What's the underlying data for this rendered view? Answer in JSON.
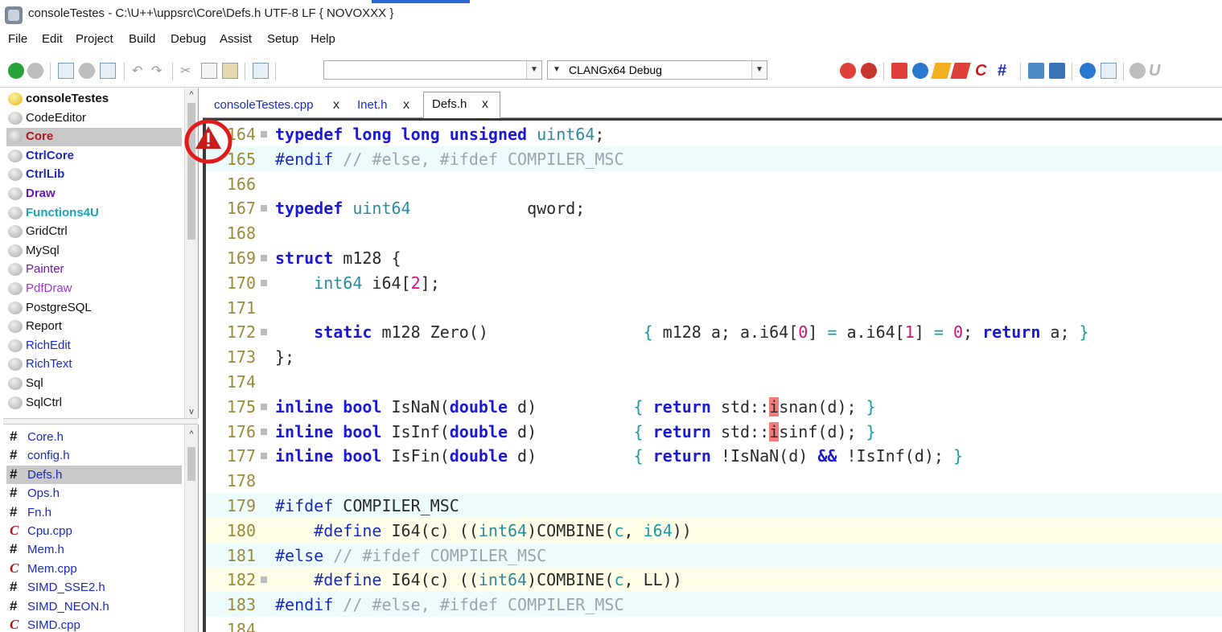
{
  "window": {
    "title": "consoleTestes - C:\\U++\\uppsrc\\Core\\Defs.h UTF-8 LF { NOVOXXX }"
  },
  "menu": [
    "File",
    "Edit",
    "Project",
    "Build",
    "Debug",
    "Assist",
    "Setup",
    "Help"
  ],
  "toolbar": {
    "config_combo_value": "",
    "build_combo_value": "CLANGx64 Debug"
  },
  "packages": {
    "items": [
      {
        "label": "consoleTestes",
        "color": "#111111",
        "bold": true,
        "main": true,
        "selected": false
      },
      {
        "label": "CodeEditor",
        "color": "#111111",
        "bold": false,
        "selected": false
      },
      {
        "label": "Core",
        "color": "#b3141a",
        "bold": true,
        "selected": true
      },
      {
        "label": "CtrlCore",
        "color": "#1a2bbf",
        "bold": true,
        "selected": false
      },
      {
        "label": "CtrlLib",
        "color": "#1a2bbf",
        "bold": true,
        "selected": false
      },
      {
        "label": "Draw",
        "color": "#6a1ab0",
        "bold": true,
        "selected": false
      },
      {
        "label": "Functions4U",
        "color": "#1aa4b8",
        "bold": true,
        "selected": false
      },
      {
        "label": "GridCtrl",
        "color": "#111111",
        "bold": false,
        "selected": false
      },
      {
        "label": "MySql",
        "color": "#111111",
        "bold": false,
        "selected": false
      },
      {
        "label": "Painter",
        "color": "#6a1ab0",
        "bold": false,
        "selected": false
      },
      {
        "label": "PdfDraw",
        "color": "#9a3ad0",
        "bold": false,
        "selected": false
      },
      {
        "label": "PostgreSQL",
        "color": "#111111",
        "bold": false,
        "selected": false
      },
      {
        "label": "Report",
        "color": "#111111",
        "bold": false,
        "selected": false
      },
      {
        "label": "RichEdit",
        "color": "#1a2bbf",
        "bold": false,
        "selected": false
      },
      {
        "label": "RichText",
        "color": "#1a2bbf",
        "bold": false,
        "selected": false
      },
      {
        "label": "Sql",
        "color": "#111111",
        "bold": false,
        "selected": false
      },
      {
        "label": "SqlCtrl",
        "color": "#111111",
        "bold": false,
        "selected": false
      }
    ]
  },
  "files": {
    "items": [
      {
        "label": "Core.h",
        "icon": "#",
        "kind": "header",
        "selected": false
      },
      {
        "label": "config.h",
        "icon": "#",
        "kind": "header",
        "selected": false
      },
      {
        "label": "Defs.h",
        "icon": "#",
        "kind": "header",
        "selected": true
      },
      {
        "label": "Ops.h",
        "icon": "#",
        "kind": "header",
        "selected": false
      },
      {
        "label": "Fn.h",
        "icon": "#",
        "kind": "header",
        "selected": false
      },
      {
        "label": "Cpu.cpp",
        "icon": "C",
        "kind": "cpp",
        "selected": false
      },
      {
        "label": "Mem.h",
        "icon": "#",
        "kind": "header",
        "selected": false
      },
      {
        "label": "Mem.cpp",
        "icon": "C",
        "kind": "cpp",
        "selected": false
      },
      {
        "label": "SIMD_SSE2.h",
        "icon": "#",
        "kind": "header",
        "selected": false
      },
      {
        "label": "SIMD_NEON.h",
        "icon": "#",
        "kind": "header",
        "selected": false
      },
      {
        "label": "SIMD.cpp",
        "icon": "C",
        "kind": "cpp",
        "selected": false
      }
    ]
  },
  "tabs": [
    {
      "label": "consoleTestes.cpp",
      "close": "x",
      "active": false
    },
    {
      "label": "Inet.h",
      "close": "x",
      "active": false
    },
    {
      "label": "Defs.h",
      "close": "x",
      "active": true
    }
  ],
  "editor": {
    "lines": [
      {
        "num": "164",
        "fold": true,
        "hl": "",
        "segs": [
          [
            "kw",
            "typedef long long unsigned "
          ],
          [
            "ty",
            "uint64"
          ],
          [
            "pln",
            ";"
          ]
        ]
      },
      {
        "num": "165",
        "fold": false,
        "hl": "cyan",
        "segs": [
          [
            "pp",
            "#endif "
          ],
          [
            "cm",
            "// #else, #ifdef COMPILER_MSC"
          ]
        ]
      },
      {
        "num": "166",
        "fold": false,
        "hl": "",
        "segs": []
      },
      {
        "num": "167",
        "fold": true,
        "hl": "",
        "segs": [
          [
            "kw",
            "typedef "
          ],
          [
            "ty",
            "uint64"
          ],
          [
            "pln",
            "            qword;"
          ]
        ]
      },
      {
        "num": "168",
        "fold": false,
        "hl": "",
        "segs": []
      },
      {
        "num": "169",
        "fold": true,
        "hl": "",
        "segs": [
          [
            "kw",
            "struct "
          ],
          [
            "pln",
            "m128 {"
          ]
        ]
      },
      {
        "num": "170",
        "fold": true,
        "hl": "",
        "segs": [
          [
            "pln",
            "    "
          ],
          [
            "ty",
            "int64"
          ],
          [
            "pln",
            " i64["
          ],
          [
            "num",
            "2"
          ],
          [
            "pln",
            "];"
          ]
        ]
      },
      {
        "num": "171",
        "fold": false,
        "hl": "",
        "segs": []
      },
      {
        "num": "172",
        "fold": true,
        "hl": "",
        "segs": [
          [
            "pln",
            "    "
          ],
          [
            "kw",
            "static "
          ],
          [
            "pln",
            "m128 Zero()                "
          ],
          [
            "brc",
            "{"
          ],
          [
            "pln",
            " m128 a; a.i64["
          ],
          [
            "num",
            "0"
          ],
          [
            "pln",
            "] "
          ],
          [
            "brc",
            "="
          ],
          [
            "pln",
            " a.i64["
          ],
          [
            "num",
            "1"
          ],
          [
            "pln",
            "] "
          ],
          [
            "brc",
            "="
          ],
          [
            "pln",
            " "
          ],
          [
            "num",
            "0"
          ],
          [
            "pln",
            "; "
          ],
          [
            "kw",
            "return "
          ],
          [
            "pln",
            "a; "
          ],
          [
            "brc",
            "}"
          ]
        ]
      },
      {
        "num": "173",
        "fold": false,
        "hl": "",
        "segs": [
          [
            "pln",
            "};"
          ]
        ]
      },
      {
        "num": "174",
        "fold": false,
        "hl": "",
        "segs": []
      },
      {
        "num": "175",
        "fold": true,
        "hl": "",
        "segs": [
          [
            "kw",
            "inline bool "
          ],
          [
            "pln",
            "IsNaN("
          ],
          [
            "kw",
            "double "
          ],
          [
            "pln",
            "d)          "
          ],
          [
            "brc",
            "{"
          ],
          [
            "pln",
            " "
          ],
          [
            "kw",
            "return "
          ],
          [
            "pln",
            "std::"
          ],
          [
            "err",
            "i"
          ],
          [
            "pln",
            "snan(d); "
          ],
          [
            "brc",
            "}"
          ]
        ]
      },
      {
        "num": "176",
        "fold": true,
        "hl": "",
        "segs": [
          [
            "kw",
            "inline bool "
          ],
          [
            "pln",
            "IsInf("
          ],
          [
            "kw",
            "double "
          ],
          [
            "pln",
            "d)          "
          ],
          [
            "brc",
            "{"
          ],
          [
            "pln",
            " "
          ],
          [
            "kw",
            "return "
          ],
          [
            "pln",
            "std::"
          ],
          [
            "err",
            "i"
          ],
          [
            "pln",
            "sinf(d); "
          ],
          [
            "brc",
            "}"
          ]
        ]
      },
      {
        "num": "177",
        "fold": true,
        "hl": "",
        "segs": [
          [
            "kw",
            "inline bool "
          ],
          [
            "pln",
            "IsFin("
          ],
          [
            "kw",
            "double "
          ],
          [
            "pln",
            "d)          "
          ],
          [
            "brc",
            "{"
          ],
          [
            "pln",
            " "
          ],
          [
            "kw",
            "return "
          ],
          [
            "pln",
            "!IsNaN(d) "
          ],
          [
            "kw",
            "&&"
          ],
          [
            "pln",
            " !IsInf(d); "
          ],
          [
            "brc",
            "}"
          ]
        ]
      },
      {
        "num": "178",
        "fold": false,
        "hl": "",
        "segs": []
      },
      {
        "num": "179",
        "fold": false,
        "hl": "cyan",
        "segs": [
          [
            "pp",
            "#ifdef "
          ],
          [
            "pln",
            "COMPILER_MSC"
          ]
        ]
      },
      {
        "num": "180",
        "fold": false,
        "hl": "yellow",
        "segs": [
          [
            "pln",
            "    "
          ],
          [
            "pp",
            "#define "
          ],
          [
            "pln",
            "I64(c) (("
          ],
          [
            "ty",
            "int64"
          ],
          [
            "pln",
            ")COMBINE("
          ],
          [
            "brc",
            "c"
          ],
          [
            "pln",
            ", "
          ],
          [
            "brc",
            "i64"
          ],
          [
            "pln",
            "))"
          ]
        ]
      },
      {
        "num": "181",
        "fold": false,
        "hl": "cyan",
        "segs": [
          [
            "pp",
            "#else "
          ],
          [
            "cm",
            "// #ifdef COMPILER_MSC"
          ]
        ]
      },
      {
        "num": "182",
        "fold": true,
        "hl": "yellow",
        "segs": [
          [
            "pln",
            "    "
          ],
          [
            "pp",
            "#define "
          ],
          [
            "pln",
            "I64(c) (("
          ],
          [
            "ty",
            "int64"
          ],
          [
            "pln",
            ")COMBINE("
          ],
          [
            "brc",
            "c"
          ],
          [
            "pln",
            ", LL))"
          ]
        ]
      },
      {
        "num": "183",
        "fold": false,
        "hl": "cyan",
        "segs": [
          [
            "pp",
            "#endif "
          ],
          [
            "cm",
            "// #else, #ifdef COMPILER_MSC"
          ]
        ]
      },
      {
        "num": "184",
        "fold": false,
        "hl": "",
        "segs": []
      }
    ]
  },
  "colors": {
    "keyword": "#1a1ad6",
    "type": "#2a8aa0",
    "preprocessor": "#1a2bbf",
    "comment": "#9ba4ad",
    "number": "#d0107a",
    "error_mark": "#f57a7a",
    "annotation_circle": "#e01b1b"
  }
}
